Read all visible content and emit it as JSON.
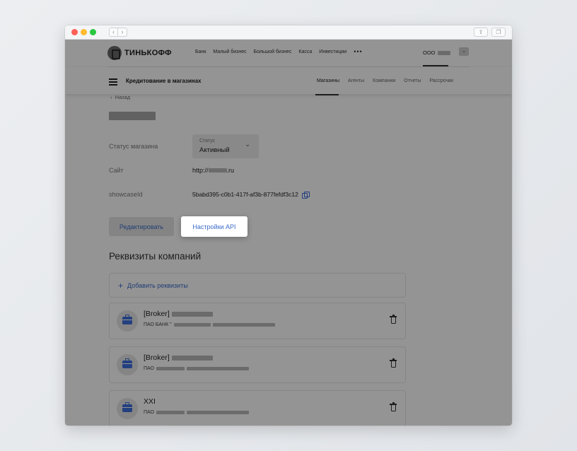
{
  "browser": {
    "back_glyph": "‹",
    "forward_glyph": "›",
    "share_glyph": "⇪",
    "tabs_glyph": "❐"
  },
  "header": {
    "logo_text": "ТИНЬКОФФ",
    "menu": [
      "Банк",
      "Малый бизнес",
      "Большой бизнес",
      "Касса",
      "Инвестиции"
    ],
    "more": "•••",
    "org_prefix": "ООО",
    "user_icon_glyph": "⌄"
  },
  "subnav": {
    "product_title": "Кредитование в магазинах",
    "tabs": [
      "Магазины",
      "Агенты",
      "Компании",
      "Отчеты",
      "Рассрочки"
    ],
    "active_tab": "Магазины"
  },
  "store": {
    "back_label": "Назад",
    "status_label": "Статус магазина",
    "status_select": {
      "label": "Статус",
      "value": "Активный"
    },
    "site_label": "Сайт",
    "site_prefix": "http://",
    "site_suffix": ".ru",
    "showcase_label": "showcaseId",
    "showcase_value": "5babd395-c0b1-417f-af3b-877fefdf3c12"
  },
  "actions": {
    "edit_label": "Редактировать",
    "api_label": "Настройки API"
  },
  "requisites": {
    "title": "Реквизиты компаний",
    "add_label": "Добавить реквизиты",
    "companies": [
      {
        "name": "[Broker]",
        "sub": "ПАО БАНК \""
      },
      {
        "name": "[Broker]",
        "sub": "ПАО"
      },
      {
        "name": "XXI",
        "sub": "ПАО"
      }
    ]
  },
  "colors": {
    "accent": "#3b6cc9",
    "overlay": "rgba(0,0,0,0.42)"
  }
}
